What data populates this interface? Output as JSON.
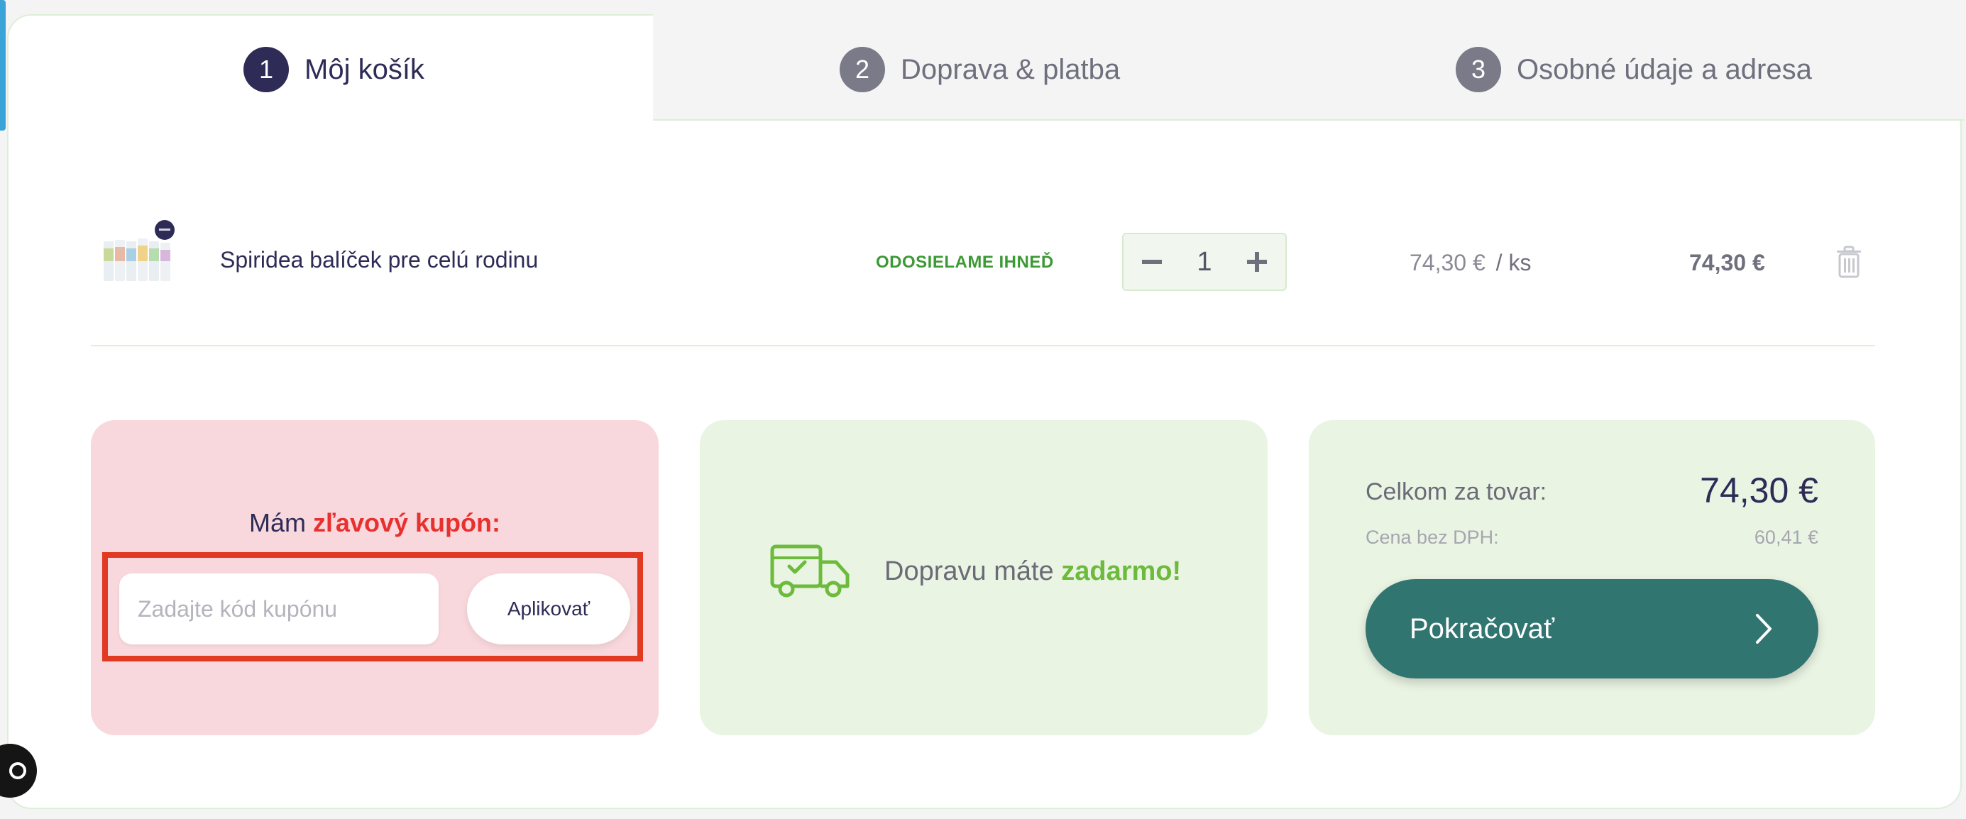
{
  "steps": [
    {
      "number": "1",
      "label": "Môj košík"
    },
    {
      "number": "2",
      "label": "Doprava & platba"
    },
    {
      "number": "3",
      "label": "Osobné údaje a adresa"
    }
  ],
  "cart": {
    "item": {
      "name": "Spiridea balíček pre celú rodinu",
      "availability": "ODOSIELAME IHNEĎ",
      "quantity": "1",
      "unit_price": "74,30 €",
      "unit_suffix": "/ ks",
      "total": "74,30 €"
    }
  },
  "coupon": {
    "title_prefix": "Mám",
    "title_highlight": "zľavový kupón:",
    "input_placeholder": "Zadajte kód kupónu",
    "apply_label": "Aplikovať"
  },
  "shipping": {
    "text": "Dopravu máte",
    "highlight": "zadarmo!"
  },
  "summary": {
    "total_label": "Celkom za tovar:",
    "total_value": "74,30 €",
    "net_label": "Cena bez DPH:",
    "net_value": "60,41 €",
    "continue_label": "Pokračovať"
  },
  "colors": {
    "primary": "#2e2c57",
    "accent_green": "#3c9a34",
    "button_teal": "#317571",
    "coupon_bg": "#f8d8dc",
    "coupon_accent": "#e8312f",
    "panel_green": "#eaf4e3"
  },
  "icons": [
    "minus-icon",
    "plus-icon",
    "trash-icon",
    "truck-icon",
    "chevron-right-icon",
    "chat-icon"
  ]
}
